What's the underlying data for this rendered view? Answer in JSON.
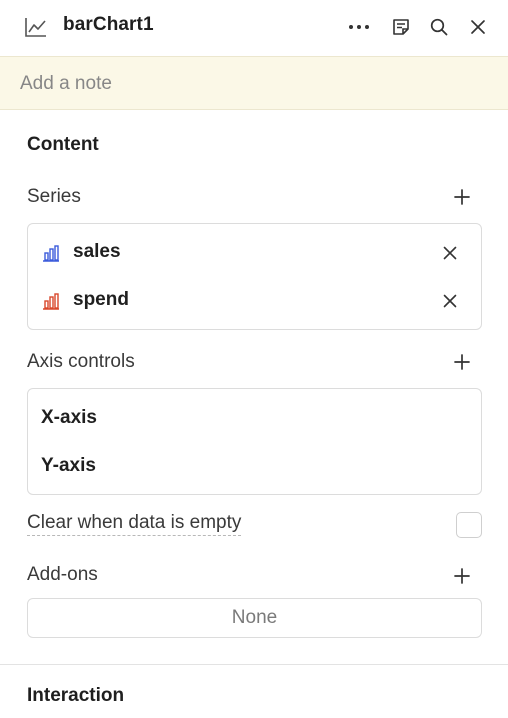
{
  "header": {
    "title": "barChart1",
    "icons": [
      "line-chart-icon",
      "more-icon",
      "notes-icon",
      "search-icon",
      "close-icon"
    ]
  },
  "note": {
    "placeholder": "Add a note",
    "value": ""
  },
  "content": {
    "title": "Content",
    "series": {
      "label": "Series",
      "items": [
        {
          "name": "sales",
          "icon": "bar-chart-icon",
          "color": "#3b5bdb"
        },
        {
          "name": "spend",
          "icon": "bar-chart-icon",
          "color": "#d9472b"
        }
      ]
    },
    "axis_controls": {
      "label": "Axis controls",
      "items": [
        "X-axis",
        "Y-axis"
      ]
    },
    "clear_when_empty": {
      "label": "Clear when data is empty",
      "checked": false
    },
    "addons": {
      "label": "Add-ons",
      "value": "None"
    }
  },
  "interaction": {
    "title": "Interaction"
  },
  "colors": {
    "note_bg": "#fbf8e7",
    "border": "#dcdcdc"
  }
}
